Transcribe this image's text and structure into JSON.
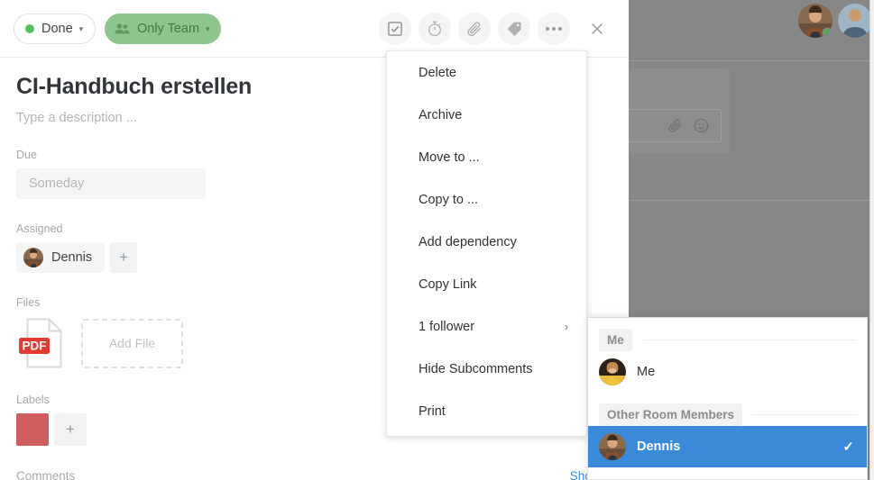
{
  "header": {
    "status_pill": {
      "label": "Done",
      "dot_color": "#56c156",
      "caret": "▾"
    },
    "visibility_pill": {
      "label": "Only Team",
      "bg_color": "#8dc68d",
      "text_color": "#3f7a3f",
      "caret": "▾",
      "icon": "people-icon"
    },
    "toolbar": [
      {
        "name": "checkbox-icon",
        "title": "Checklist"
      },
      {
        "name": "timer-icon",
        "title": "Timer"
      },
      {
        "name": "paperclip-icon",
        "title": "Attach"
      },
      {
        "name": "tag-icon",
        "title": "Label"
      },
      {
        "name": "more-icon",
        "title": "More"
      }
    ],
    "close_icon": "close-icon"
  },
  "task": {
    "title": "CI-Handbuch erstellen",
    "description_placeholder": "Type a description ...",
    "due": {
      "label": "Due",
      "value": "",
      "placeholder": "Someday"
    },
    "assigned": {
      "label": "Assigned",
      "people": [
        "Dennis"
      ],
      "add_label": "+"
    },
    "files": {
      "label": "Files",
      "items": [
        {
          "type": "PDF"
        }
      ],
      "add_label": "Add File"
    },
    "labels": {
      "label": "Labels",
      "swatches": [
        "#cf5f5f"
      ],
      "add_label": "+"
    },
    "comments": {
      "label": "Comments",
      "show_link": "Show D"
    }
  },
  "context_menu": {
    "items": [
      {
        "label": "Delete",
        "submenu": false
      },
      {
        "label": "Archive",
        "submenu": false
      },
      {
        "label": "Move to ...",
        "submenu": false
      },
      {
        "label": "Copy to ...",
        "submenu": false
      },
      {
        "label": "Add dependency",
        "submenu": false
      },
      {
        "label": "Copy Link",
        "submenu": false
      },
      {
        "label": "1 follower",
        "submenu": true,
        "arrow": "›"
      },
      {
        "label": "Hide Subcomments",
        "submenu": false
      },
      {
        "label": "Print",
        "submenu": false
      }
    ]
  },
  "followers_submenu": {
    "sections": [
      {
        "title": "Me",
        "rows": [
          {
            "name": "Me",
            "selected": false,
            "avatar": "avatar-me"
          }
        ]
      },
      {
        "title": "Other Room Members",
        "rows": [
          {
            "name": "Dennis",
            "selected": true,
            "avatar": "avatar-dennis",
            "tick": "✓"
          }
        ]
      }
    ],
    "selected_color": "#3b8ad9"
  },
  "background": {
    "avatars": [
      {
        "name": "avatar-dennis",
        "online": true
      },
      {
        "name": "avatar-member",
        "online": false
      }
    ],
    "composer_icons": [
      "paperclip-icon",
      "emoji-icon"
    ]
  }
}
